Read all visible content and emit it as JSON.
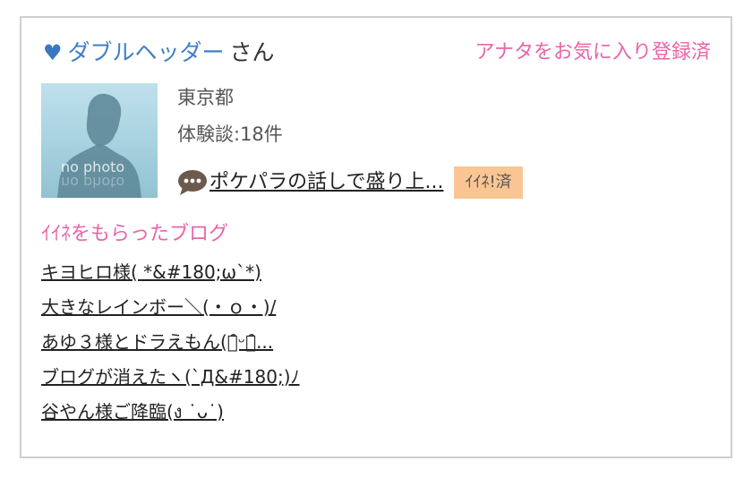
{
  "header": {
    "heart_icon": "♥",
    "username": "ダブルヘッダー",
    "honorific": "さん",
    "favorite_status": "アナタをお気に入り登録済"
  },
  "avatar": {
    "placeholder_text": "no photo"
  },
  "profile": {
    "location": "東京都",
    "experience_count": "体験談:18件"
  },
  "status": {
    "icon": "speech-bubble-icon",
    "message": "ポケパラの話しで盛り上...",
    "like_badge": "ｲｲﾈ!済"
  },
  "liked_blogs": {
    "title": "ｲｲﾈをもらったブログ",
    "items": [
      "キヨヒロ様( *&#180;ω`*)",
      "大きなレインボー＼(・ｏ・)/",
      "あゆ３様とドラえもん(ﾟ̑ᵕﾟ̑...",
      "ブログが消えたヽ(`Д&#180;)ﾉ",
      "谷やん様ご降臨(ง ˙ᴗ˙)"
    ]
  },
  "colors": {
    "accent_pink": "#e865a8",
    "username_blue": "#3f7fc6",
    "badge_orange": "#f9c592",
    "border_gray": "#cfcfcf"
  }
}
